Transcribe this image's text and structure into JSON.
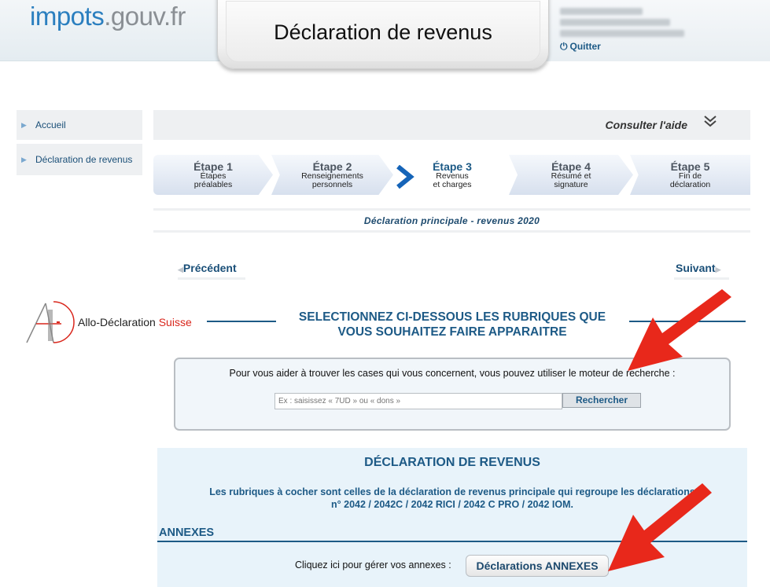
{
  "header": {
    "logo_part1": "impots",
    "logo_part2": ".gouv.fr",
    "title": "Déclaration de revenus",
    "quit_label": "Quitter"
  },
  "sidebar": {
    "items": [
      {
        "label": "Accueil"
      },
      {
        "label": "Déclaration de revenus"
      }
    ]
  },
  "help": {
    "label": "Consulter l'aide",
    "icon": "double-chevron-down-icon"
  },
  "steps": [
    {
      "title": "Étape 1",
      "line1": "Étapes",
      "line2": "préalables"
    },
    {
      "title": "Étape 2",
      "line1": "Renseignements",
      "line2": "personnels"
    },
    {
      "title": "Étape 3",
      "line1": "Revenus",
      "line2": "et charges"
    },
    {
      "title": "Étape 4",
      "line1": "Résumé et",
      "line2": "signature"
    },
    {
      "title": "Étape 5",
      "line1": "Fin de",
      "line2": "déclaration"
    }
  ],
  "current_step": 3,
  "subtitle": "Déclaration principale - revenus 2020",
  "nav": {
    "previous": "Précédent",
    "next": "Suivant"
  },
  "watermark": {
    "name": "Allo-Déclaration",
    "suffix": "Suisse"
  },
  "select": {
    "line1": "SELECTIONNEZ CI-DESSOUS LES RUBRIQUES QUE",
    "line2": "VOUS SOUHAITEZ FAIRE APPARAITRE"
  },
  "search": {
    "label": "Pour vous aider à trouver les cases qui vous concernent, vous pouvez utiliser le moteur de recherche :",
    "placeholder": "Ex : saisissez « 7UD » ou « dons »",
    "button": "Rechercher"
  },
  "declaration": {
    "title": "DÉCLARATION DE REVENUS",
    "desc_line1": "Les rubriques à cocher sont celles de la déclaration de revenus principale qui regroupe les déclarations",
    "desc_line2": "n° 2042 / 2042C / 2042 RICI / 2042 C PRO / 2042 IOM.",
    "annexes_title": "ANNEXES",
    "annexes_label": "Cliquez ici pour gérer vos annexes :",
    "annexes_button": "Déclarations ANNEXES"
  },
  "colors": {
    "primary": "#1d5a86",
    "logo_blue": "#2b7fbf",
    "arrow_red": "#e8281b",
    "panel_bg": "#e8f3fa"
  }
}
